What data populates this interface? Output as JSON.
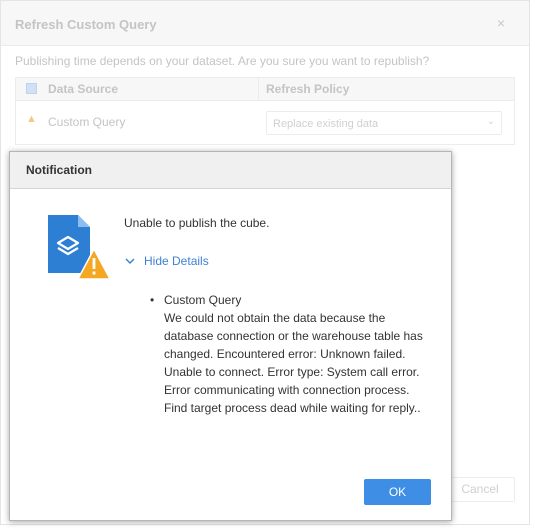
{
  "background_dialog": {
    "title": "Refresh Custom Query",
    "close": "×",
    "subtitle": "Publishing time depends on your dataset. Are you sure you want to republish?",
    "columns": [
      "Data Source",
      "Refresh Policy"
    ],
    "rows": [
      {
        "name": "Custom Query",
        "policy": "Replace existing data"
      }
    ],
    "cancel_label": "Cancel"
  },
  "notification": {
    "title": "Notification",
    "message": "Unable to publish the cube.",
    "toggle_label": "Hide Details",
    "details": [
      {
        "name": "Custom Query",
        "text": "We could not obtain the data because the database connection or the warehouse table has changed. Encountered error: Unknown failed. Unable to connect. Error type: System call error. Error communicating with connection process. Find target process dead while waiting for reply.."
      }
    ],
    "ok_label": "OK",
    "icon": "cube-file-warning-icon"
  },
  "colors": {
    "accent": "#3d8ee4",
    "link": "#3d82d6",
    "warning": "#f5a623",
    "file_blue": "#2d7fd3"
  }
}
